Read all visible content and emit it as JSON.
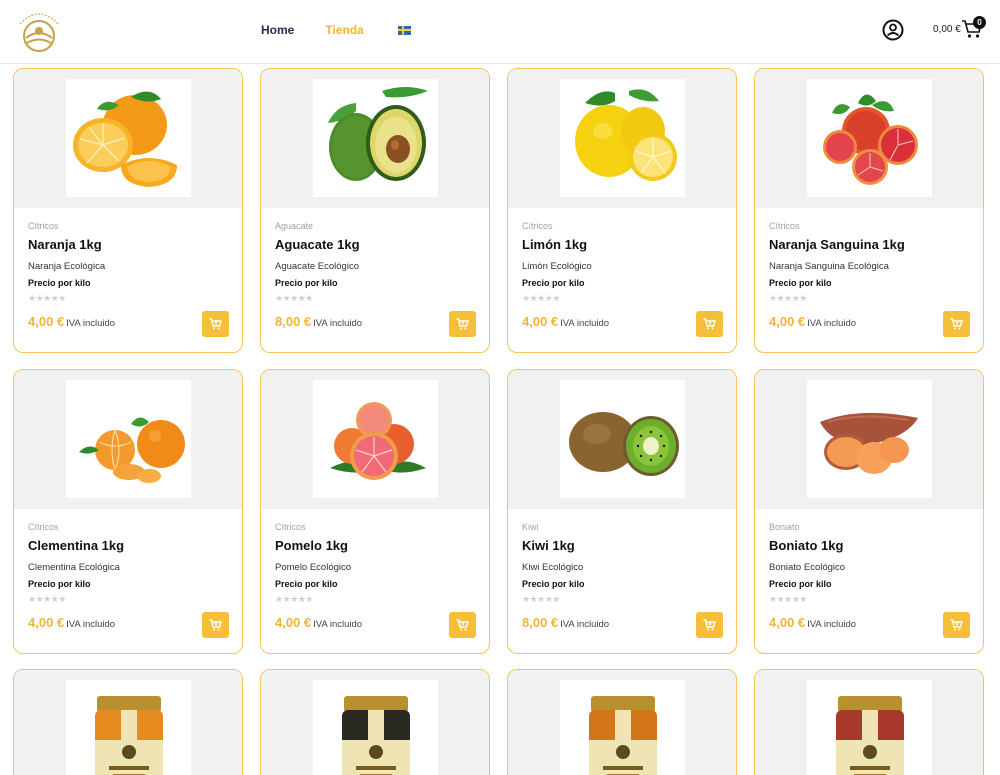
{
  "header": {
    "nav": {
      "home": "Home",
      "tienda": "Tienda"
    },
    "cart": {
      "total": "0,00 €",
      "count": "0"
    }
  },
  "theme": {
    "accent": "#f3b434",
    "border": "#f7c45c",
    "nav_dark": "#1f2b4d"
  },
  "products": [
    {
      "category": "Cítricos",
      "name": "Naranja 1kg",
      "description": "Naranja Ecológica",
      "price_note": "Precio por kilo",
      "price": "4,00 €",
      "tax": "IVA incluido",
      "rating": 0,
      "image": "orange"
    },
    {
      "category": "Aguacate",
      "name": "Aguacate 1kg",
      "description": "Aguacate Ecológico",
      "price_note": "Precio por kilo",
      "price": "8,00 €",
      "tax": "IVA incluido",
      "rating": 0,
      "image": "avocado"
    },
    {
      "category": "Cítricos",
      "name": "Limón 1kg",
      "description": "Limón Ecológico",
      "price_note": "Precio por kilo",
      "price": "4,00 €",
      "tax": "IVA incluido",
      "rating": 0,
      "image": "lemon"
    },
    {
      "category": "Cítricos",
      "name": "Naranja Sanguina 1kg",
      "description": "Naranja Sanguina Ecológica",
      "price_note": "Precio por kilo",
      "price": "4,00 €",
      "tax": "IVA incluido",
      "rating": 0,
      "image": "blood-orange"
    },
    {
      "category": "Cítricos",
      "name": "Clementina 1kg",
      "description": "Clementina Ecológica",
      "price_note": "Precio por kilo",
      "price": "4,00 €",
      "tax": "IVA incluido",
      "rating": 0,
      "image": "clementine"
    },
    {
      "category": "Cítricos",
      "name": "Pomelo 1kg",
      "description": "Pomelo Ecológico",
      "price_note": "Precio por kilo",
      "price": "4,00 €",
      "tax": "IVA incluido",
      "rating": 0,
      "image": "grapefruit"
    },
    {
      "category": "Kiwi",
      "name": "Kiwi 1kg",
      "description": "Kiwi Ecológico",
      "price_note": "Precio por kilo",
      "price": "8,00 €",
      "tax": "IVA incluido",
      "rating": 0,
      "image": "kiwi"
    },
    {
      "category": "Boniato",
      "name": "Boniato 1kg",
      "description": "Boniato Ecológico",
      "price_note": "Precio por kilo",
      "price": "4,00 €",
      "tax": "IVA incluido",
      "rating": 0,
      "image": "sweet-potato"
    }
  ],
  "honey_products": [
    {
      "image": "honey-jar",
      "lid": "#b8902f",
      "fill": "#e58b1f"
    },
    {
      "image": "honey-jar",
      "lid": "#b8902f",
      "fill": "#2b2a22"
    },
    {
      "image": "honey-jar",
      "lid": "#b8902f",
      "fill": "#d47518"
    },
    {
      "image": "honey-jar",
      "lid": "#b8902f",
      "fill": "#a8392a"
    }
  ]
}
